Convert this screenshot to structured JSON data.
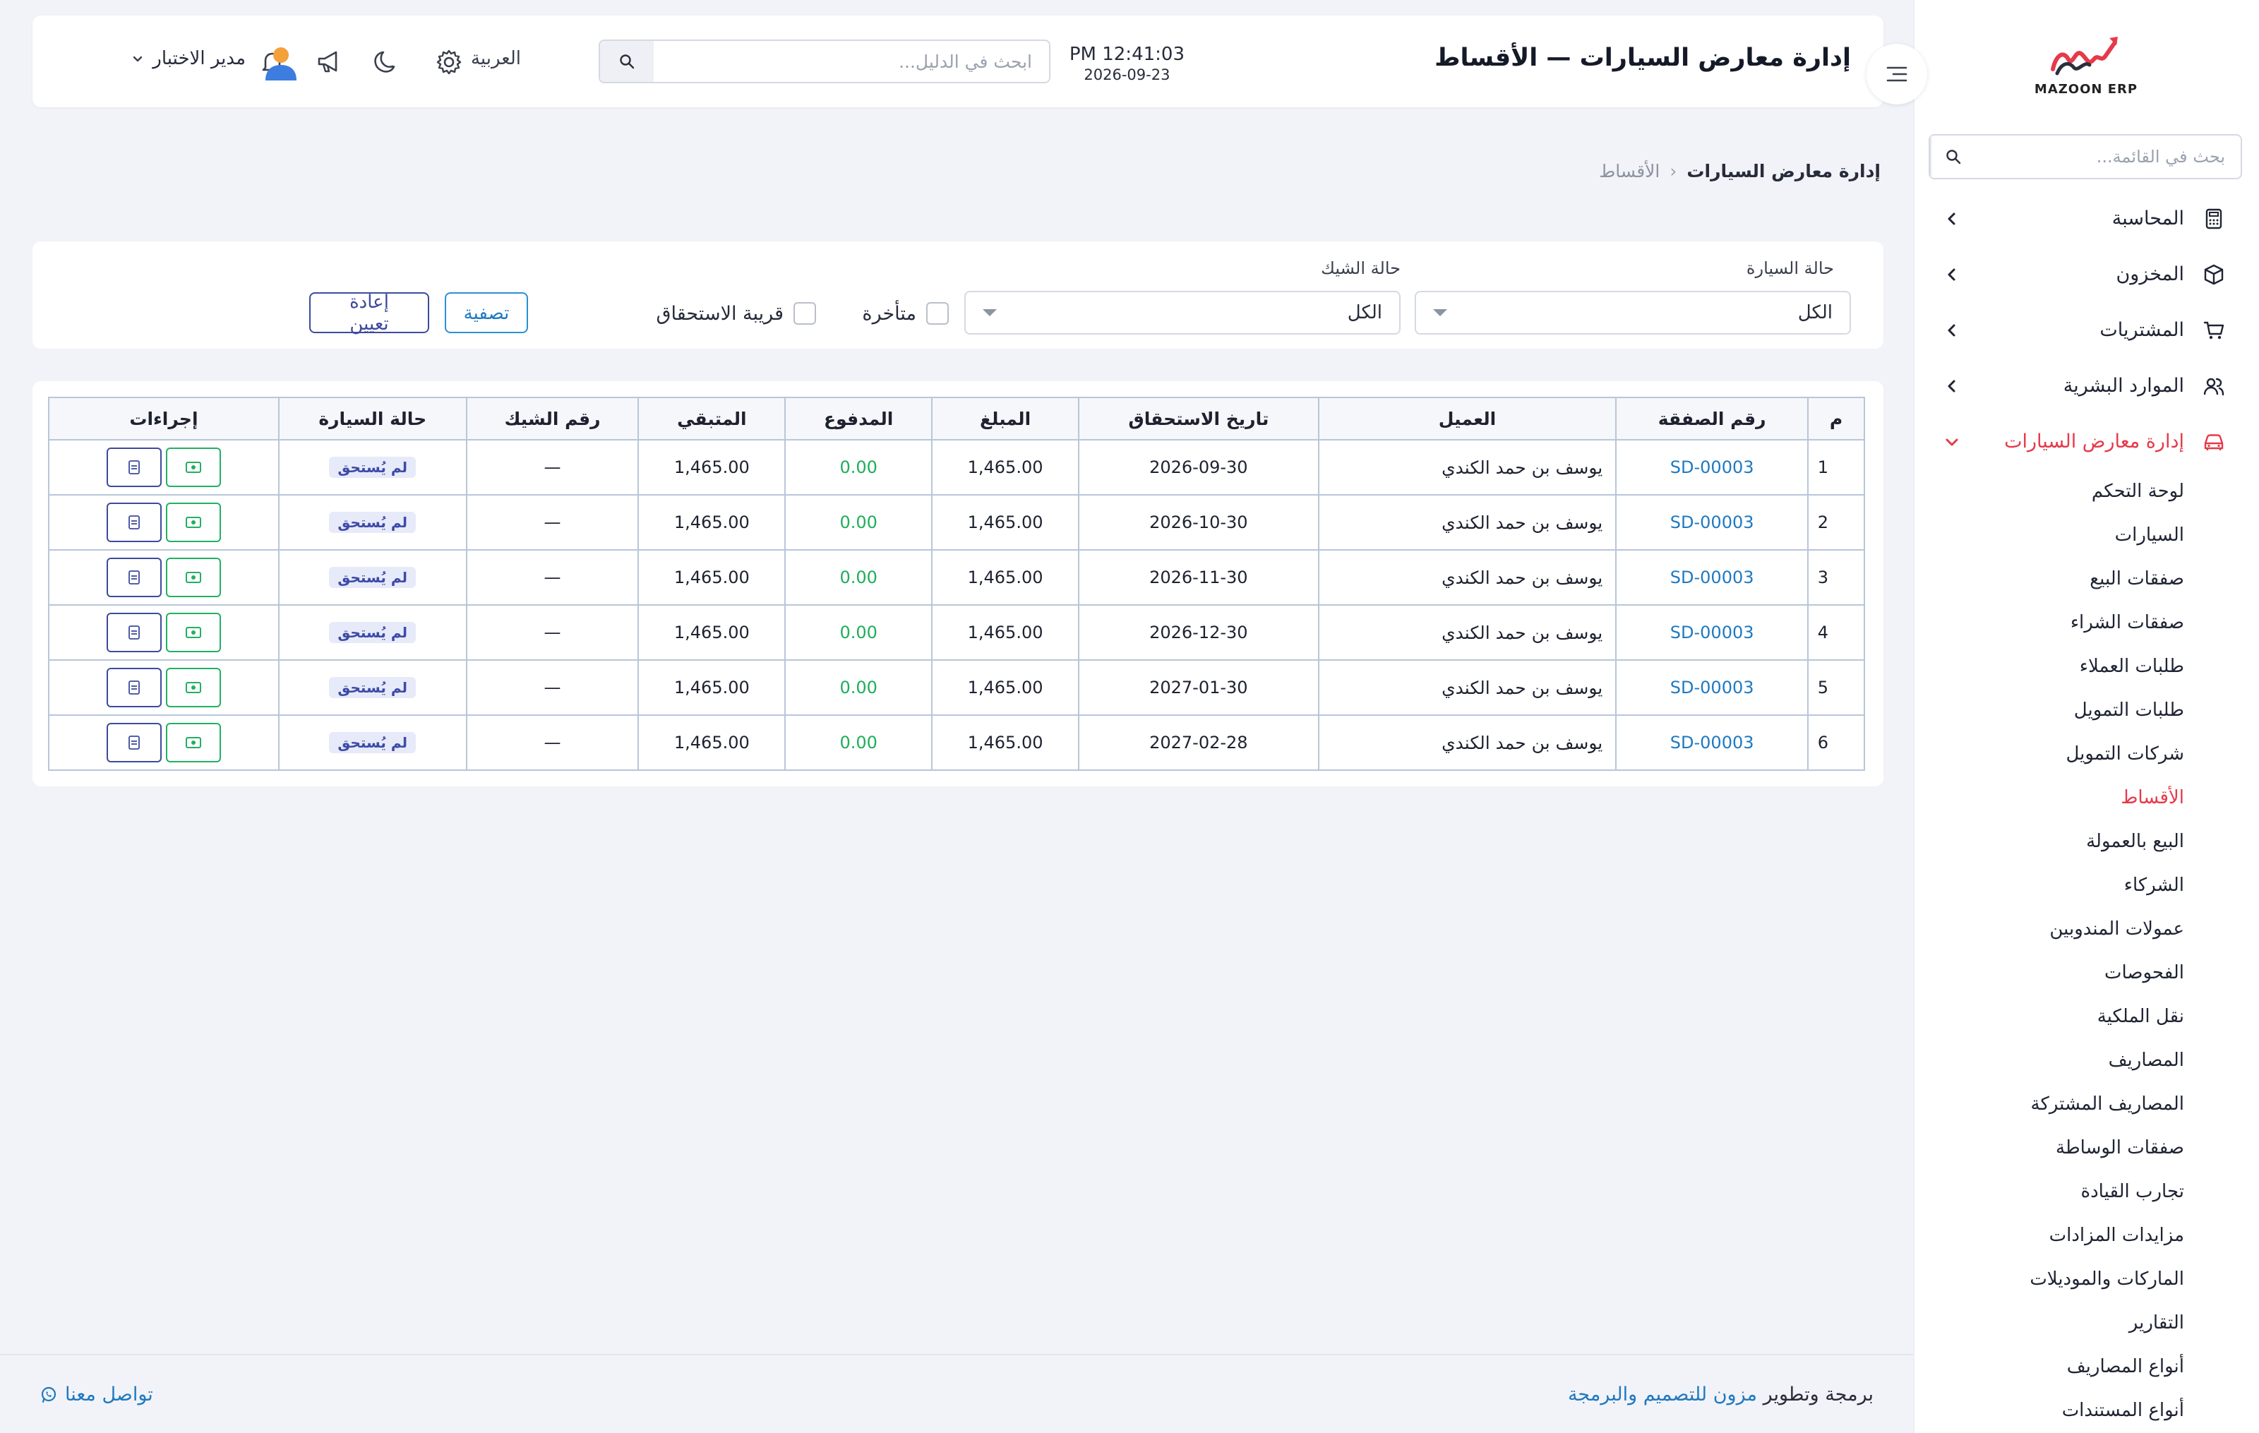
{
  "brand": {
    "logo_text": "MAZOON ERP"
  },
  "sidebar": {
    "search_placeholder": "بحث في القائمة...",
    "menu": [
      {
        "label": "المحاسبة",
        "icon": "calculator-icon"
      },
      {
        "label": "المخزون",
        "icon": "box-icon"
      },
      {
        "label": "المشتريات",
        "icon": "cart-icon"
      },
      {
        "label": "الموارد البشرية",
        "icon": "users-icon"
      },
      {
        "label": "إدارة معارض السيارات",
        "icon": "car-icon",
        "active": true
      }
    ],
    "submenu": [
      "لوحة التحكم",
      "السيارات",
      "صفقات البيع",
      "صفقات الشراء",
      "طلبات العملاء",
      "طلبات التمويل",
      "شركات التمويل",
      "الأقساط",
      "البيع بالعمولة",
      "الشركاء",
      "عمولات المندوبين",
      "الفحوصات",
      "نقل الملكية",
      "المصاريف",
      "المصاريف المشتركة",
      "صفقات الوساطة",
      "تجارب القيادة",
      "مزايدات المزادات",
      "الماركات والموديلات",
      "التقارير",
      "أنواع المصاريف",
      "أنواع المستندات"
    ],
    "active_submenu_index": 7
  },
  "header": {
    "title": "إدارة معارض السيارات — الأقساط",
    "time": "PM 12:41:03",
    "date": "2026-09-23",
    "search_placeholder": "ابحث في الدليل...",
    "language": "العربية",
    "user_name": "مدير الاختبار"
  },
  "breadcrumb": {
    "parent": "إدارة معارض السيارات",
    "separator": "‹",
    "current": "الأقساط"
  },
  "filters": {
    "car_status_label": "حالة السيارة",
    "car_status_value": "الكل",
    "check_status_label": "حالة الشيك",
    "check_status_value": "الكل",
    "overdue_label": "متأخرة",
    "due_soon_label": "قريبة الاستحقاق",
    "filter_button": "تصفية",
    "reset_button": "إعادة تعيين"
  },
  "table": {
    "headers": {
      "num": "م",
      "deal": "رقم الصفقة",
      "client": "العميل",
      "due": "تاريخ الاستحقاق",
      "amount": "المبلغ",
      "paid": "المدفوع",
      "remaining": "المتبقي",
      "check": "رقم الشيك",
      "car_status": "حالة السيارة",
      "actions": "إجراءات"
    },
    "rows": [
      {
        "num": "1",
        "deal": "SD-00003",
        "client": "يوسف بن حمد الكندي",
        "due": "2026-09-30",
        "amount": "1,465.00",
        "paid": "0.00",
        "remaining": "1,465.00",
        "check": "—",
        "status": "لم يُستحق"
      },
      {
        "num": "2",
        "deal": "SD-00003",
        "client": "يوسف بن حمد الكندي",
        "due": "2026-10-30",
        "amount": "1,465.00",
        "paid": "0.00",
        "remaining": "1,465.00",
        "check": "—",
        "status": "لم يُستحق"
      },
      {
        "num": "3",
        "deal": "SD-00003",
        "client": "يوسف بن حمد الكندي",
        "due": "2026-11-30",
        "amount": "1,465.00",
        "paid": "0.00",
        "remaining": "1,465.00",
        "check": "—",
        "status": "لم يُستحق"
      },
      {
        "num": "4",
        "deal": "SD-00003",
        "client": "يوسف بن حمد الكندي",
        "due": "2026-12-30",
        "amount": "1,465.00",
        "paid": "0.00",
        "remaining": "1,465.00",
        "check": "—",
        "status": "لم يُستحق"
      },
      {
        "num": "5",
        "deal": "SD-00003",
        "client": "يوسف بن حمد الكندي",
        "due": "2027-01-30",
        "amount": "1,465.00",
        "paid": "0.00",
        "remaining": "1,465.00",
        "check": "—",
        "status": "لم يُستحق"
      },
      {
        "num": "6",
        "deal": "SD-00003",
        "client": "يوسف بن حمد الكندي",
        "due": "2027-02-28",
        "amount": "1,465.00",
        "paid": "0.00",
        "remaining": "1,465.00",
        "check": "—",
        "status": "لم يُستحق"
      }
    ]
  },
  "footer": {
    "credit_prefix": "برمجة وتطوير",
    "credit_link": "مزون للتصميم والبرمجة",
    "contact": "تواصل معنا"
  },
  "colors": {
    "accent": "#e53a4b",
    "link": "#1f79c0",
    "paid": "#1fae5a",
    "badge_bg": "#e7eaf9"
  }
}
